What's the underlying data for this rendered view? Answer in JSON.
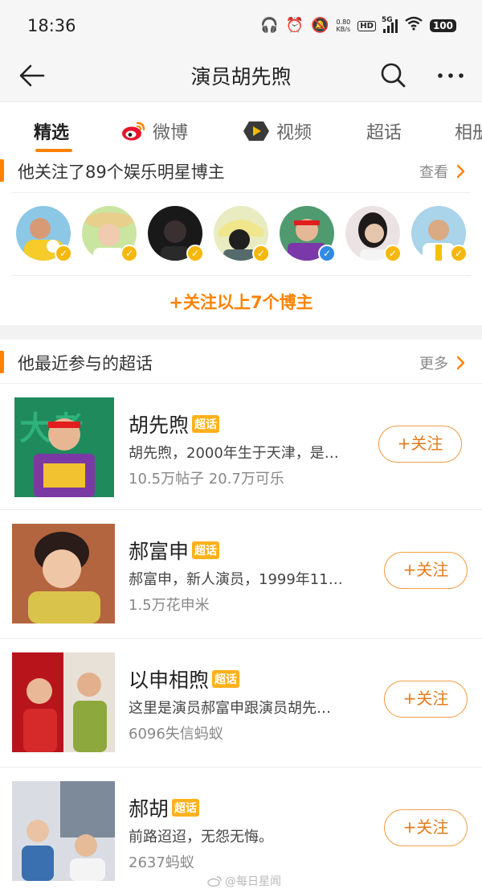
{
  "status_bar": {
    "time": "18:36",
    "net_speed_value": "0.80",
    "net_speed_unit": "KB/s",
    "hd": "HD",
    "network": "5G",
    "battery": "100"
  },
  "header": {
    "title": "演员胡先煦"
  },
  "tabs": [
    {
      "label": "精选",
      "active": true
    },
    {
      "label": "微博",
      "active": false
    },
    {
      "label": "视频",
      "active": false
    },
    {
      "label": "超话",
      "active": false
    },
    {
      "label": "相册",
      "active": false
    }
  ],
  "following": {
    "title": "他关注了89个娱乐明星博主",
    "more_label": "查看",
    "follow_all_label": "+关注以上7个博主",
    "avatars": [
      {
        "badge": "v",
        "badge_color": "#f5b80b",
        "bg": "#8cc8e6",
        "face": "#d79a74"
      },
      {
        "badge": "v",
        "badge_color": "#f5b80b",
        "bg": "#c9e5a0",
        "face": "#f0cbb0"
      },
      {
        "badge": "v",
        "badge_color": "#f5b80b",
        "bg": "#191919",
        "face": "#3a3030"
      },
      {
        "badge": "v",
        "badge_color": "#f5b80b",
        "bg": "#e9ecc0",
        "face": "#202020"
      },
      {
        "badge": "v",
        "badge_color": "#2f8ae6",
        "bg": "#4f9a6e",
        "face": "#e4b896"
      },
      {
        "badge": "v",
        "badge_color": "#f5b80b",
        "bg": "#ebe3e3",
        "face": "#e6c5ad"
      },
      {
        "badge": "v",
        "badge_color": "#f5b80b",
        "bg": "#a9d4ea",
        "face": "#d9aa84"
      }
    ]
  },
  "topics_section": {
    "title": "他最近参与的超话",
    "more_label": "更多",
    "items": [
      {
        "name": "胡先煦",
        "tag": "超话",
        "desc": "胡先煦，2000年生于天津，是…",
        "stats": "10.5万帖子 20.7万可乐",
        "button": "+关注"
      },
      {
        "name": "郝富申",
        "tag": "超话",
        "desc": "郝富申，新人演员，1999年11…",
        "stats": "1.5万花申米",
        "button": "+关注"
      },
      {
        "name": "以申相煦",
        "tag": "超话",
        "desc": "这里是演员郝富申跟演员胡先…",
        "stats": "6096失信蚂蚁",
        "button": "+关注"
      },
      {
        "name": "郝胡",
        "tag": "超话",
        "desc": "前路迢迢，无怨无悔。",
        "stats": "2637蚂蚁",
        "button": "+关注"
      }
    ]
  },
  "watermark": "@每日星闻",
  "colors": {
    "accent": "#ff8200",
    "button_border": "#f1a04b",
    "tag": "#ffb11b"
  }
}
